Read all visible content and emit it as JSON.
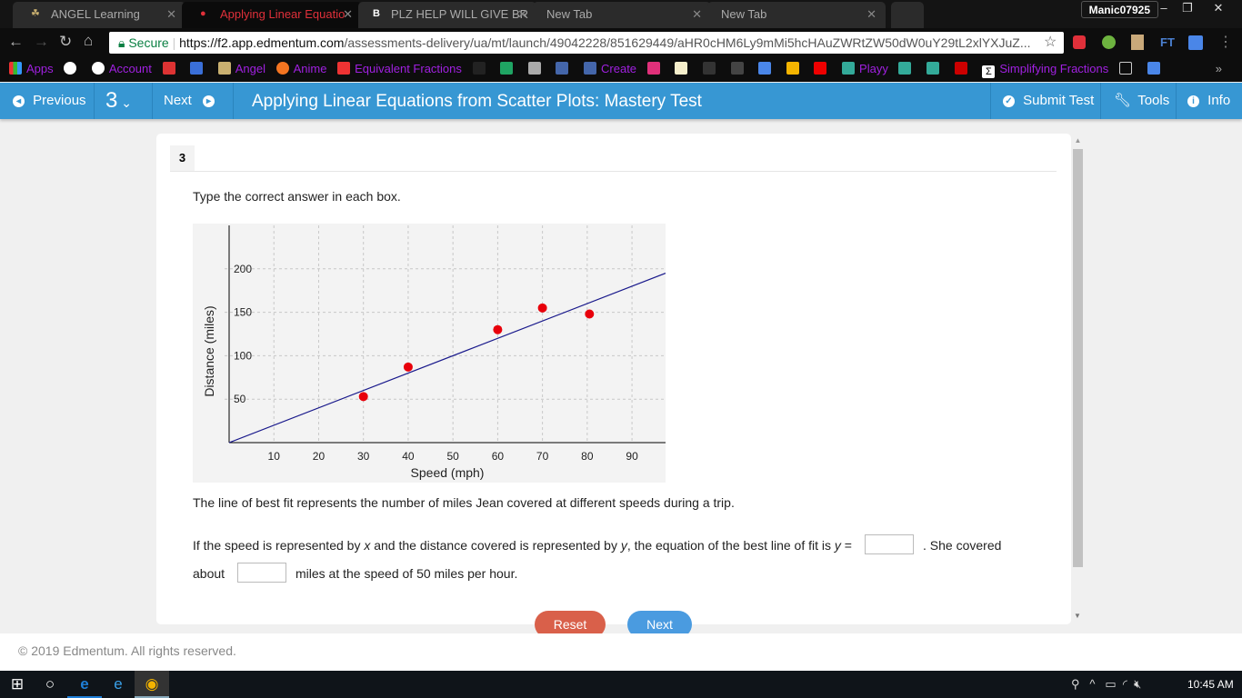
{
  "browser": {
    "tabs": [
      {
        "label": "ANGEL Learning",
        "active": false
      },
      {
        "label": "Applying Linear Equatio",
        "active": true
      },
      {
        "label": "PLZ HELP WILL GIVE BR",
        "active": false
      },
      {
        "label": "New Tab",
        "active": false
      },
      {
        "label": "New Tab",
        "active": false
      }
    ],
    "profile": "Manic07925",
    "secure_label": "Secure",
    "url_host": "https://f2.app.edmentum.com",
    "url_path": "/assessments-delivery/ua/mt/launch/49042228/851629449/aHR0cHM6Ly9mMi5hcHAuZWRtZW50dW0uY29tL2xlYXJuZ...",
    "extension_ft": "FT",
    "bookmarks": [
      "Apps",
      "",
      "Account",
      "",
      "",
      "Angel",
      "Anime",
      "Equivalent Fractions",
      "",
      "",
      "",
      "",
      "Create",
      "",
      "",
      "",
      "",
      "",
      "",
      "",
      "Playy",
      "",
      "",
      "",
      "Simplifying Fractions",
      "",
      ""
    ]
  },
  "header": {
    "previous": "Previous",
    "question_number": "3",
    "next": "Next",
    "title": "Applying Linear Equations from Scatter Plots: Mastery Test",
    "submit": "Submit Test",
    "tools": "Tools",
    "info": "Info"
  },
  "question": {
    "number": "3",
    "instruction": "Type the correct answer in each box.",
    "context": "The line of best fit represents the number of miles Jean covered at different speeds during a trip.",
    "part1_a": "If the speed is represented by ",
    "var_x": "x",
    "part1_b": " and the distance covered is represented by ",
    "var_y": "y",
    "part1_c": ", the equation of the best line of fit is ",
    "var_y2": "y",
    "part1_d": " = ",
    "part2": ". She covered",
    "part3": "about",
    "part4": "miles at the speed of 50 miles per hour.",
    "answer1": "",
    "answer2": ""
  },
  "buttons": {
    "reset": "Reset",
    "next": "Next"
  },
  "footer": "© 2019 Edmentum. All rights reserved.",
  "taskbar": {
    "time": "10:45 AM"
  },
  "chart_data": {
    "type": "scatter",
    "xlabel": "Speed (mph)",
    "ylabel": "Distance (miles)",
    "xlim": [
      0,
      97.5
    ],
    "ylim": [
      0,
      250
    ],
    "xticks": [
      10,
      20,
      30,
      40,
      50,
      60,
      70,
      80,
      90
    ],
    "yticks": [
      50,
      100,
      150,
      200
    ],
    "grid": true,
    "points": [
      {
        "x": 30,
        "y": 53
      },
      {
        "x": 40,
        "y": 87
      },
      {
        "x": 60,
        "y": 130
      },
      {
        "x": 70,
        "y": 155
      },
      {
        "x": 80.5,
        "y": 148
      }
    ],
    "best_fit": {
      "slope": 2,
      "intercept": 0
    },
    "colors": {
      "points": "#e8000b",
      "line": "#1a1a8c"
    }
  }
}
